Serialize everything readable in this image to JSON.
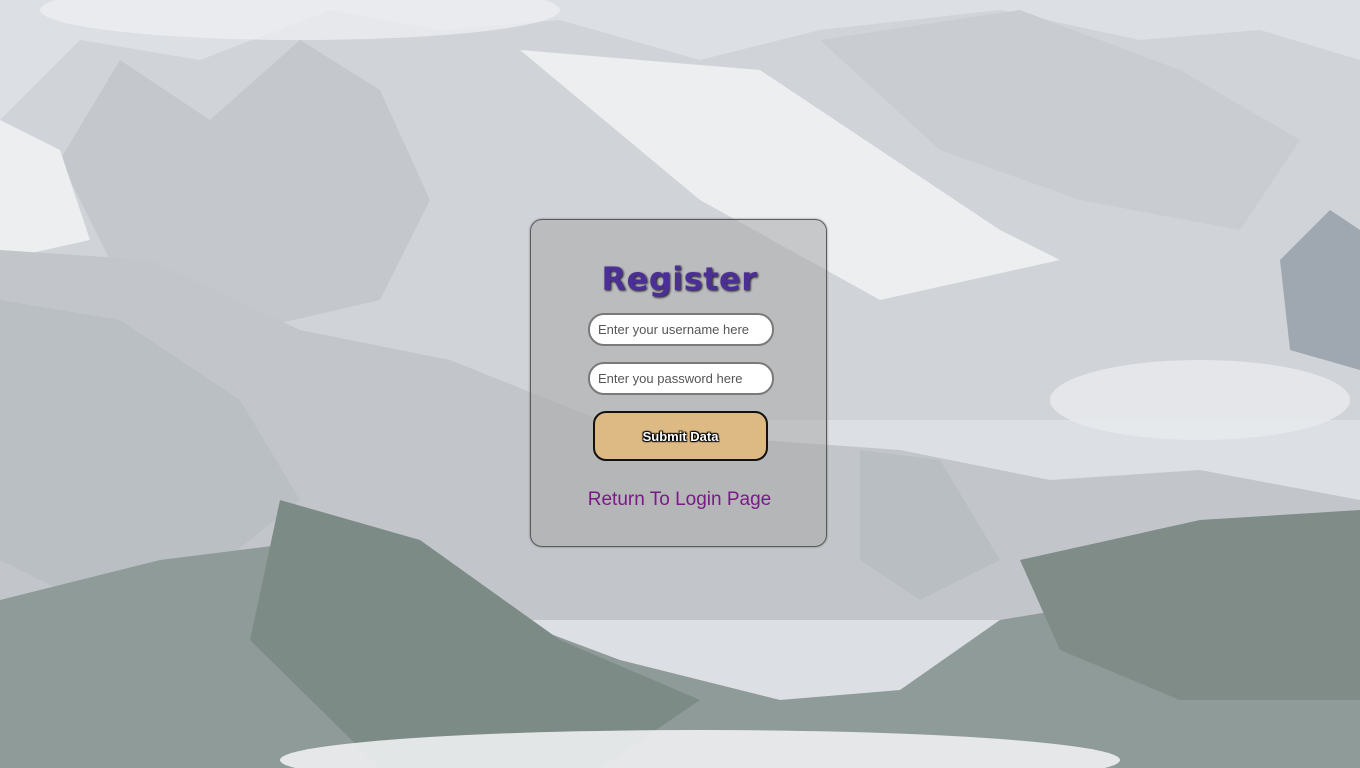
{
  "form": {
    "title": "Register",
    "username_placeholder": "Enter your username here",
    "password_placeholder": "Enter you password here",
    "submit_label": "Submit Data",
    "login_link_label": "Return To Login Page"
  },
  "colors": {
    "title": "#4b2f94",
    "submit_background": "#ddb984",
    "link": "#7b1a86"
  }
}
